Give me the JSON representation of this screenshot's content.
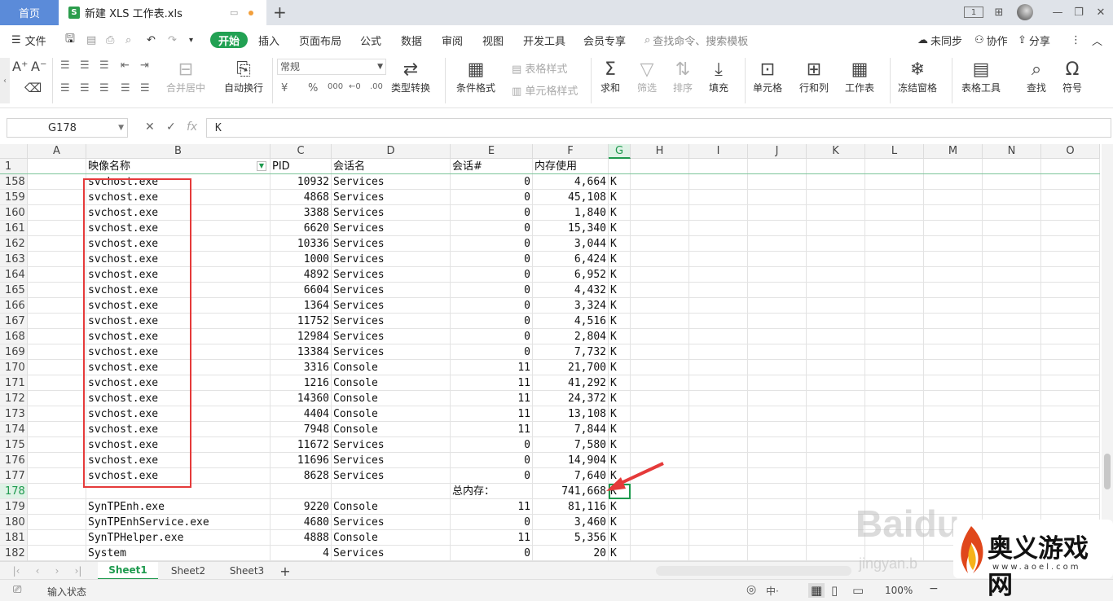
{
  "titlebar": {
    "home_tab": "首页",
    "doc_tab": "新建 XLS 工作表.xls",
    "xls_letter": "S",
    "new_tab": "+",
    "avatar_label": "1"
  },
  "menubar": {
    "file": "文件",
    "items": [
      "开始",
      "插入",
      "页面布局",
      "公式",
      "数据",
      "审阅",
      "视图",
      "开发工具",
      "会员专享"
    ],
    "search": "查找命令、搜索模板",
    "sync": "未同步",
    "collab": "协作",
    "share": "分享"
  },
  "ribbon": {
    "number_format": "常规",
    "buttons": {
      "merge": "合并居中",
      "wrap": "自动换行",
      "convert": "类型转换",
      "cond_format": "条件格式",
      "table_style": "表格样式",
      "cell_style": "单元格样式",
      "sum": "求和",
      "filter": "筛选",
      "sort": "排序",
      "fill": "填充",
      "cell": "单元格",
      "rowcol": "行和列",
      "sheet": "工作表",
      "freeze": "冻结窗格",
      "table_tools": "表格工具",
      "find": "查找",
      "symbol": "符号"
    }
  },
  "formula": {
    "cell_ref": "G178",
    "value": "K"
  },
  "grid": {
    "columns": [
      "A",
      "B",
      "C",
      "D",
      "E",
      "F",
      "G",
      "H",
      "I",
      "J",
      "K",
      "L",
      "M",
      "N",
      "O"
    ],
    "selected_column": "G",
    "header_row": {
      "num": "1",
      "b": "映像名称",
      "c": "PID",
      "d": "会话名",
      "e": "会话#",
      "f": "内存使用"
    },
    "rows": [
      {
        "num": "158",
        "b": "svchost.exe",
        "c": "10932",
        "d": "Services",
        "e": "0",
        "f": "4,664",
        "g": "K"
      },
      {
        "num": "159",
        "b": "svchost.exe",
        "c": "4868",
        "d": "Services",
        "e": "0",
        "f": "45,108",
        "g": "K"
      },
      {
        "num": "160",
        "b": "svchost.exe",
        "c": "3388",
        "d": "Services",
        "e": "0",
        "f": "1,840",
        "g": "K"
      },
      {
        "num": "161",
        "b": "svchost.exe",
        "c": "6620",
        "d": "Services",
        "e": "0",
        "f": "15,340",
        "g": "K"
      },
      {
        "num": "162",
        "b": "svchost.exe",
        "c": "10336",
        "d": "Services",
        "e": "0",
        "f": "3,044",
        "g": "K"
      },
      {
        "num": "163",
        "b": "svchost.exe",
        "c": "1000",
        "d": "Services",
        "e": "0",
        "f": "6,424",
        "g": "K"
      },
      {
        "num": "164",
        "b": "svchost.exe",
        "c": "4892",
        "d": "Services",
        "e": "0",
        "f": "6,952",
        "g": "K"
      },
      {
        "num": "165",
        "b": "svchost.exe",
        "c": "6604",
        "d": "Services",
        "e": "0",
        "f": "4,432",
        "g": "K"
      },
      {
        "num": "166",
        "b": "svchost.exe",
        "c": "1364",
        "d": "Services",
        "e": "0",
        "f": "3,324",
        "g": "K"
      },
      {
        "num": "167",
        "b": "svchost.exe",
        "c": "11752",
        "d": "Services",
        "e": "0",
        "f": "4,516",
        "g": "K"
      },
      {
        "num": "168",
        "b": "svchost.exe",
        "c": "12984",
        "d": "Services",
        "e": "0",
        "f": "2,804",
        "g": "K"
      },
      {
        "num": "169",
        "b": "svchost.exe",
        "c": "13384",
        "d": "Services",
        "e": "0",
        "f": "7,732",
        "g": "K"
      },
      {
        "num": "170",
        "b": "svchost.exe",
        "c": "3316",
        "d": "Console",
        "e": "11",
        "f": "21,700",
        "g": "K"
      },
      {
        "num": "171",
        "b": "svchost.exe",
        "c": "1216",
        "d": "Console",
        "e": "11",
        "f": "41,292",
        "g": "K"
      },
      {
        "num": "172",
        "b": "svchost.exe",
        "c": "14360",
        "d": "Console",
        "e": "11",
        "f": "24,372",
        "g": "K"
      },
      {
        "num": "173",
        "b": "svchost.exe",
        "c": "4404",
        "d": "Console",
        "e": "11",
        "f": "13,108",
        "g": "K"
      },
      {
        "num": "174",
        "b": "svchost.exe",
        "c": "7948",
        "d": "Console",
        "e": "11",
        "f": "7,844",
        "g": "K"
      },
      {
        "num": "175",
        "b": "svchost.exe",
        "c": "11672",
        "d": "Services",
        "e": "0",
        "f": "7,580",
        "g": "K"
      },
      {
        "num": "176",
        "b": "svchost.exe",
        "c": "11696",
        "d": "Services",
        "e": "0",
        "f": "14,904",
        "g": "K"
      },
      {
        "num": "177",
        "b": "svchost.exe",
        "c": "8628",
        "d": "Services",
        "e": "0",
        "f": "7,640",
        "g": "K"
      },
      {
        "num": "178",
        "b": "",
        "c": "",
        "d": "",
        "e": "总内存：",
        "f": "741,668",
        "g": "K"
      },
      {
        "num": "179",
        "b": "SynTPEnh.exe",
        "c": "9220",
        "d": "Console",
        "e": "11",
        "f": "81,116",
        "g": "K"
      },
      {
        "num": "180",
        "b": "SynTPEnhService.exe",
        "c": "4680",
        "d": "Services",
        "e": "0",
        "f": "3,460",
        "g": "K"
      },
      {
        "num": "181",
        "b": "SynTPHelper.exe",
        "c": "4888",
        "d": "Console",
        "e": "11",
        "f": "5,356",
        "g": "K"
      },
      {
        "num": "182",
        "b": "System",
        "c": "4",
        "d": "Services",
        "e": "0",
        "f": "20",
        "g": "K"
      }
    ],
    "selected_row": "178"
  },
  "sheets": {
    "tabs": [
      "Sheet1",
      "Sheet2",
      "Sheet3"
    ],
    "active": "Sheet1",
    "add": "+"
  },
  "status": {
    "mode": "输入状态",
    "zoom": "100%"
  },
  "watermark": {
    "baidu": "Baidu",
    "jingyan": "jingyan.b",
    "brand": "奥义游戏网",
    "url": "www.aoel.com"
  },
  "colors": {
    "accent": "#1e9a4e",
    "start_button": "#22a153",
    "home_tab": "#5b8bd9",
    "highlight_box": "#e53a3a",
    "arrow": "#e53a3a"
  }
}
